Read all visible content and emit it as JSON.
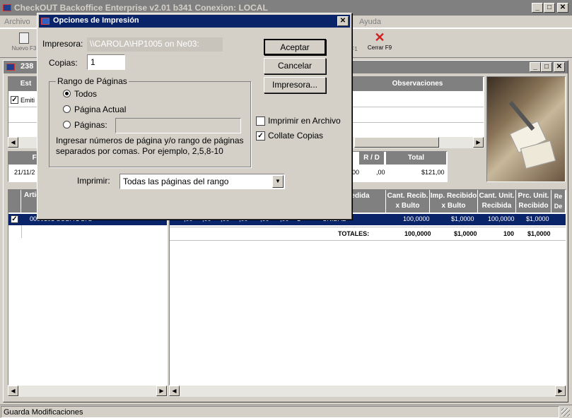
{
  "app": {
    "title": "CheckOUT Backoffice Enterprise v2.01 b341 Conexion: LOCAL",
    "menu": [
      "Archivo",
      "Ayuda"
    ]
  },
  "toolbar": {
    "new_label": "Nuevo F3",
    "partial_label": "F1",
    "close_label": "Cerrar F9"
  },
  "mdi": {
    "title": "238",
    "top_grid": {
      "headers": [
        "Est",
        "Observaciones"
      ],
      "row_text": "Emiti"
    },
    "date_row": {
      "headers": [
        "Fe",
        "R / D",
        "Total"
      ],
      "values": [
        "21/11/2",
        "00",
        ",00",
        "$121,00"
      ]
    },
    "left_grid": {
      "header": "Artic",
      "row_value": "0000101 SODA 1 LTS"
    },
    "right_grid": {
      "headers": [
        "d. Medida",
        "Cant. Recib. x Bulto",
        "Imp. Recibido x Bulto",
        "Cant. Unit. Recibida",
        "Prc. Unit. Recibido",
        "Re De"
      ],
      "row": [
        ",00",
        ",00",
        ",00",
        ",00",
        ",00",
        ",00",
        "1",
        "UNIDAD",
        "100,0000",
        "$1,0000",
        "100,0000",
        "$1,0000"
      ],
      "totals_label": "TOTALES:",
      "totals": [
        "100,0000",
        "$1,0000",
        "100",
        "$1,0000"
      ]
    }
  },
  "dialog": {
    "title": "Opciones de Impresión",
    "printer_label": "Impresora:",
    "printer_value": "\\\\CAROLA\\HP1005 on Ne03:",
    "copies_label": "Copias:",
    "copies_value": "1",
    "range_group": "Rango de Páginas",
    "options": [
      "Todos",
      "Página Actual",
      "Páginas:"
    ],
    "hint": "Ingresar números de página y/o rango de páginas separados por comas. Por ejemplo, 2,5,8-10",
    "accept": "Aceptar",
    "cancel": "Cancelar",
    "printer_btn": "Impresora...",
    "print_to_file": "Imprimir en Archivo",
    "collate": "Collate Copias",
    "print_label": "Imprimir:",
    "print_select": "Todas las páginas del rango"
  },
  "status": {
    "text": "Guarda Modificaciones"
  },
  "colors": {
    "dialog_title": "#0a246a",
    "selection": "#0a246a",
    "window_face": "#d4d0c8"
  }
}
